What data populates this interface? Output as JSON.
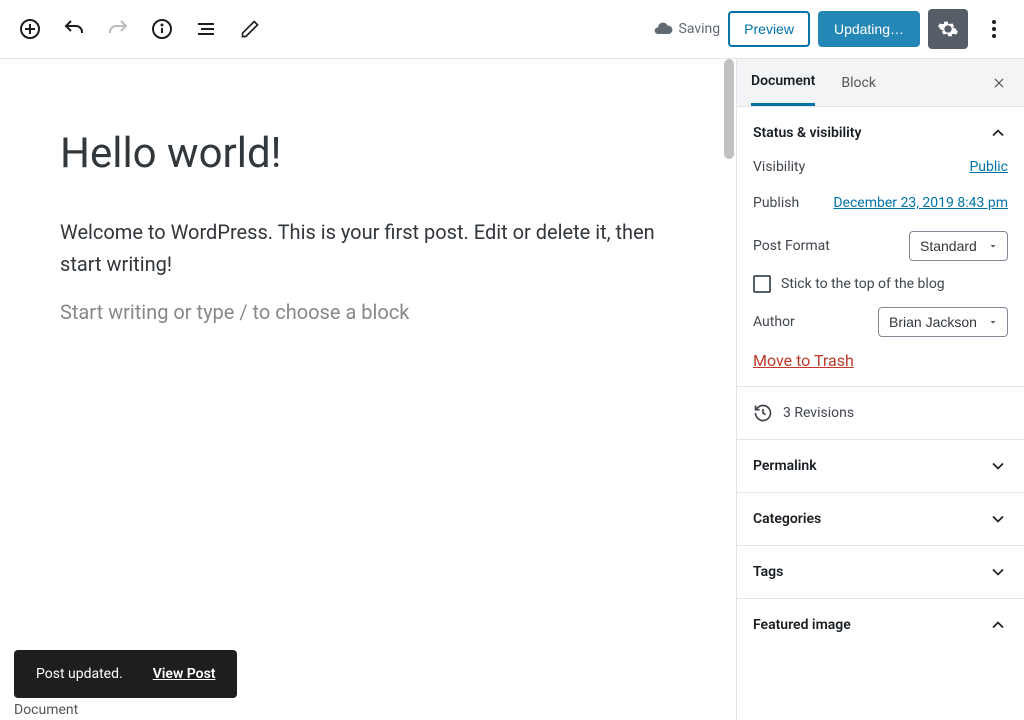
{
  "toolbar": {
    "saving": "Saving",
    "preview": "Preview",
    "publish": "Updating…"
  },
  "editor": {
    "title": "Hello world!",
    "body": "Welcome to WordPress. This is your first post. Edit or delete it, then start writing!",
    "placeholder": "Start writing or type / to choose a block"
  },
  "tabs": {
    "document": "Document",
    "block": "Block"
  },
  "sidebar": {
    "status": {
      "title": "Status & visibility",
      "visibility_label": "Visibility",
      "visibility_value": "Public",
      "publish_label": "Publish",
      "publish_value": "December 23, 2019 8:43 pm",
      "format_label": "Post Format",
      "format_value": "Standard",
      "sticky_label": "Stick to the top of the blog",
      "author_label": "Author",
      "author_value": "Brian Jackson",
      "trash": "Move to Trash"
    },
    "revisions": "3 Revisions",
    "panels": {
      "permalink": "Permalink",
      "categories": "Categories",
      "tags": "Tags",
      "featured": "Featured image"
    }
  },
  "toast": {
    "message": "Post updated.",
    "action": "View Post"
  },
  "footer": "Document"
}
